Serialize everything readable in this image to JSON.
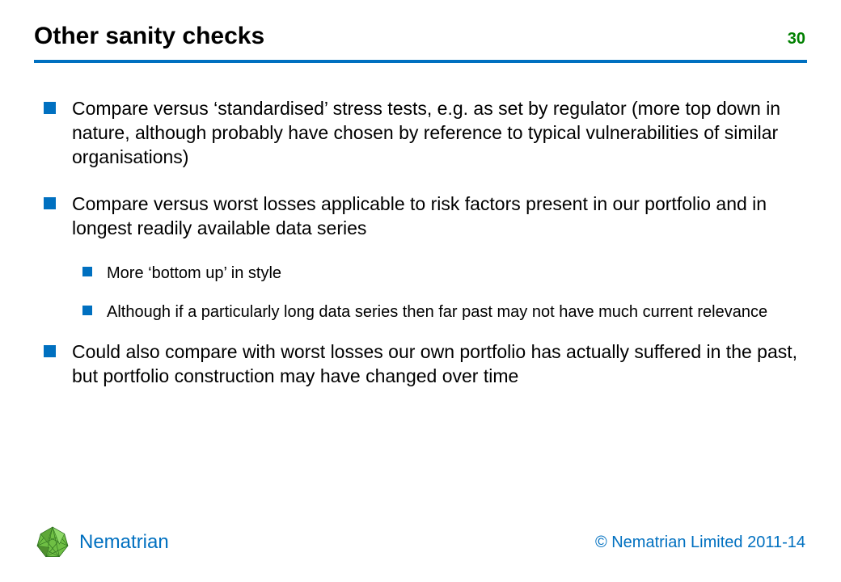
{
  "slide": {
    "title": "Other sanity checks",
    "number": "30",
    "brand": "Nematrian",
    "copyright": "© Nematrian Limited 2011-14"
  },
  "bullets": [
    {
      "level": 1,
      "text": "Compare versus ‘standardised’ stress tests, e.g. as set by regulator (more top down in nature, although probably have chosen by reference to typical vulnerabilities of similar organisations)"
    },
    {
      "level": 1,
      "text": "Compare versus worst losses applicable to risk factors present in our portfolio and in longest readily available data series"
    },
    {
      "level": 2,
      "text": "More ‘bottom up’ in style"
    },
    {
      "level": 2,
      "text": "Although if a particularly long data series then far past may not have much current relevance"
    },
    {
      "level": 1,
      "text": "Could also compare with worst losses our own portfolio has actually suffered in the past, but portfolio construction may have changed over time"
    }
  ]
}
